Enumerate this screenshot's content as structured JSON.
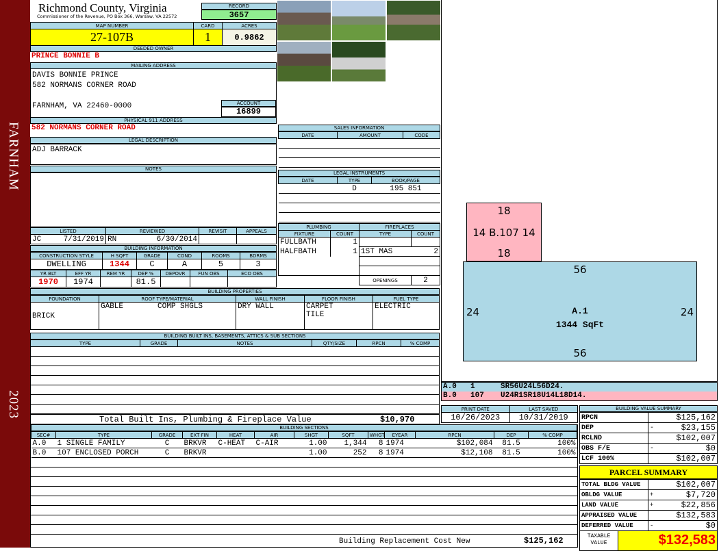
{
  "sidebar": {
    "town": "FARNHAM",
    "year": "2023"
  },
  "header": {
    "county": "Richmond County, Virginia",
    "office": "Commissioner of the Revenue, PO Box 366, Warsaw, VA 22572",
    "record_label": "RECORD",
    "record": "3657"
  },
  "parcel": {
    "map_label": "MAP NUMBER",
    "map": "27-107B",
    "card_label": "CARD",
    "card": "1",
    "acres_label": "ACRES",
    "acres": "0.9862",
    "owner_label": "DEEDED OWNER",
    "owner": "PRINCE BONNIE B",
    "mail_label": "MAILING ADDRESS",
    "mail": [
      "DAVIS BONNIE PRINCE",
      "582 NORMANS CORNER ROAD",
      "FARNHAM, VA 22460-0000"
    ],
    "account_label": "ACCOUNT",
    "account": "16899",
    "addr_label": "PHYSICAL 911 ADDRESS",
    "addr": "582 NORMANS CORNER ROAD",
    "legal_label": "LEGAL DESCRIPTION",
    "legal": "ADJ BARRACK",
    "notes_label": "NOTES"
  },
  "review": {
    "headers": [
      "LISTED",
      "REVIEWED",
      "REVISIT",
      "APPEALS"
    ],
    "listed_by": "JC",
    "listed": "7/31/2019",
    "reviewed_by": "RN",
    "reviewed": "6/30/2014"
  },
  "bldg_info": {
    "label": "BUILDING INFORMATION",
    "h1": [
      "CONSTRUCTION STYLE",
      "H SQFT",
      "GRADE",
      "COND",
      "ROOMS",
      "BDRMS"
    ],
    "v1": [
      "DWELLING",
      "1344",
      "C",
      "A",
      "5",
      "3"
    ],
    "h2": [
      "YR BLT",
      "EFF YR",
      "REM YR",
      "DEP %",
      "DEPOVR",
      "FUN OBS",
      "ECO OBS"
    ],
    "v2": [
      "1970",
      "1974",
      "",
      "81.5",
      "",
      "",
      ""
    ]
  },
  "sales": {
    "label": "SALES INFORMATION",
    "headers": [
      "DATE",
      "AMOUNT",
      "CODE"
    ]
  },
  "instruments": {
    "label": "LEGAL INSTRUMENTS",
    "headers": [
      "DATE",
      "TYPE",
      "BOOK/PAGE"
    ],
    "rows": [
      [
        "",
        "D",
        "195 851"
      ]
    ]
  },
  "plumbing": {
    "label": "PLUMBING",
    "headers": [
      "FIXTURE",
      "COUNT"
    ],
    "rows": [
      [
        "FULLBATH",
        "1"
      ],
      [
        "HALFBATH",
        "1"
      ]
    ]
  },
  "fireplaces": {
    "label": "FIREPLACES",
    "headers": [
      "TYPE",
      "COUNT"
    ],
    "rows": [
      [
        "1ST MAS",
        "2"
      ]
    ],
    "openings_label": "OPENINGS",
    "openings": "2"
  },
  "properties": {
    "label": "BUILDING PROPERTIES",
    "headers": [
      "FOUNDATION",
      "ROOF TYPE/MATERIAL",
      "WALL FINISH",
      "FLOOR FINISH",
      "FUEL TYPE"
    ],
    "foundation": "BRICK",
    "roof_type": "GABLE",
    "roof_mat": "COMP SHGLS",
    "wall": "DRY WALL",
    "floor": [
      "CARPET",
      "TILE"
    ],
    "fuel": "ELECTRIC"
  },
  "builtins": {
    "label": "BUILDING BUILT INS, BASEMENTS, ATTICS & SUB SECTIONS",
    "headers": [
      "TYPE",
      "GRADE",
      "NOTES",
      "QTY/SIZE",
      "RPCN",
      "% COMP"
    ],
    "total_label": "Total Built Ins, Plumbing & Fireplace Value",
    "total": "$10,970"
  },
  "dates": {
    "print_label": "PRINT DATE",
    "print": "10/26/2023",
    "saved_label": "LAST SAVED",
    "saved": "10/31/2019"
  },
  "sections": {
    "label": "BUILDING SECTIONS",
    "headers": [
      "SEC#",
      "TYPE",
      "GRADE",
      "EXT FIN",
      "HEAT",
      "AIR",
      "SHGT",
      "SQFT",
      "WHGT",
      "EYEAR",
      "RPCN",
      "DEP",
      "% COMP"
    ],
    "rows": [
      [
        "A.0",
        "1 SINGLE FAMILY",
        "C",
        "BRKVR",
        "C-HEAT",
        "C-AIR",
        "1.00",
        "1,344",
        "8",
        "1974",
        "$102,084",
        "81.5",
        "100%"
      ],
      [
        "B.0",
        "107 ENCLOSED PORCH",
        "C",
        "BRKVR",
        "",
        "",
        "1.00",
        "252",
        "8",
        "1974",
        "$12,108",
        "81.5",
        "100%"
      ]
    ],
    "total_label": "Building Replacement Cost New",
    "total": "$125,162"
  },
  "sketch": {
    "b": {
      "top": "18",
      "left": "14",
      "right": "14",
      "bottom": "18",
      "label": "B.107"
    },
    "a": {
      "top": "56",
      "left": "24",
      "right": "24",
      "bottom": "56",
      "label": "A.1",
      "area": "1344 SqFt"
    },
    "legend": [
      [
        "A.0",
        "1",
        "SR56U24L56D24."
      ],
      [
        "B.0",
        "107",
        "U24R1SR18U14L18D14."
      ]
    ]
  },
  "value_summary": {
    "label": "BUILDING VALUE SUMMARY",
    "rows": [
      [
        "RPCN",
        "",
        "$125,162"
      ],
      [
        "DEP",
        "-",
        "$23,155"
      ],
      [
        "RCLND",
        "",
        "$102,007"
      ],
      [
        "OBS F/E",
        "-",
        "$0"
      ],
      [
        "LCF 100%",
        "",
        "$102,007"
      ]
    ]
  },
  "parcel_summary": {
    "label": "PARCEL SUMMARY",
    "rows": [
      [
        "TOTAL BLDG VALUE",
        "",
        "$102,007"
      ],
      [
        "OBLDG VALUE",
        "+",
        "$7,720"
      ],
      [
        "LAND VALUE",
        "+",
        "$22,856"
      ],
      [
        "APPRAISED VALUE",
        "",
        "$132,583"
      ],
      [
        "DEFERRED VALUE",
        "-",
        "$0"
      ]
    ],
    "taxable_label": "TAXABLE VALUE",
    "taxable": "$132,583"
  }
}
